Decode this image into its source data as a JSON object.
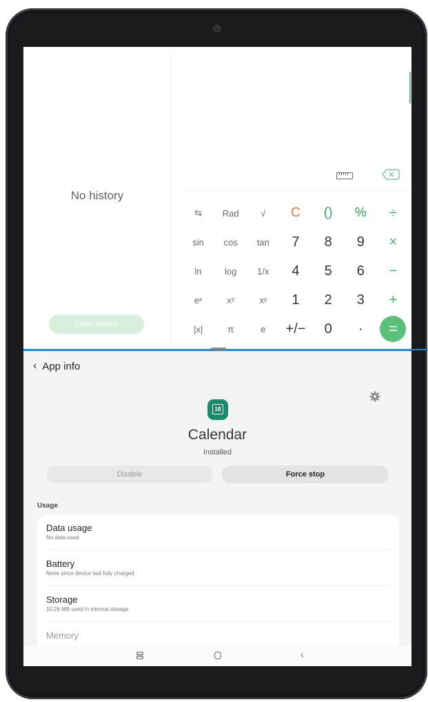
{
  "calculator": {
    "history_empty": "No history",
    "clear_history": "Clear history",
    "keys": [
      [
        {
          "label": "⇆",
          "kind": "sm"
        },
        {
          "label": "Rad",
          "kind": "sm"
        },
        {
          "label": "√",
          "kind": "sm"
        },
        {
          "label": "C",
          "kind": "clear"
        },
        {
          "label": "()",
          "kind": "green"
        },
        {
          "label": "%",
          "kind": "green"
        },
        {
          "label": "÷",
          "kind": "op"
        }
      ],
      [
        {
          "label": "sin",
          "kind": "sm"
        },
        {
          "label": "cos",
          "kind": "sm"
        },
        {
          "label": "tan",
          "kind": "sm"
        },
        {
          "label": "7",
          "kind": "num"
        },
        {
          "label": "8",
          "kind": "num"
        },
        {
          "label": "9",
          "kind": "num"
        },
        {
          "label": "×",
          "kind": "op"
        }
      ],
      [
        {
          "label": "ln",
          "kind": "sm"
        },
        {
          "label": "log",
          "kind": "sm"
        },
        {
          "label": "1/x",
          "kind": "sm"
        },
        {
          "label": "4",
          "kind": "num"
        },
        {
          "label": "5",
          "kind": "num"
        },
        {
          "label": "6",
          "kind": "num"
        },
        {
          "label": "−",
          "kind": "op"
        }
      ],
      [
        {
          "label": "eˣ",
          "kind": "sm"
        },
        {
          "label": "x²",
          "kind": "sm"
        },
        {
          "label": "xʸ",
          "kind": "sm"
        },
        {
          "label": "1",
          "kind": "num"
        },
        {
          "label": "2",
          "kind": "num"
        },
        {
          "label": "3",
          "kind": "num"
        },
        {
          "label": "+",
          "kind": "op"
        }
      ],
      [
        {
          "label": "|x|",
          "kind": "sm"
        },
        {
          "label": "π",
          "kind": "sm"
        },
        {
          "label": "e",
          "kind": "sm"
        },
        {
          "label": "+/−",
          "kind": "num"
        },
        {
          "label": "0",
          "kind": "num"
        },
        {
          "label": "·",
          "kind": "num"
        },
        {
          "label": "=",
          "kind": "eq"
        }
      ]
    ],
    "icons": {
      "ruler": "ruler-icon",
      "backspace": "backspace-icon"
    },
    "accent_color": "#5bc07a"
  },
  "app_info": {
    "back_label": "App info",
    "app_name": "Calendar",
    "app_icon_text": "18",
    "status": "Installed",
    "disable_label": "Disable",
    "force_stop_label": "Force stop",
    "section_usage": "Usage",
    "items": [
      {
        "title": "Data usage",
        "subtitle": "No data used"
      },
      {
        "title": "Battery",
        "subtitle": "None since device last fully charged"
      },
      {
        "title": "Storage",
        "subtitle": "10.26 MB used in internal storage"
      }
    ],
    "memory_label": "Memory"
  },
  "divider_color": "#1e88d6"
}
